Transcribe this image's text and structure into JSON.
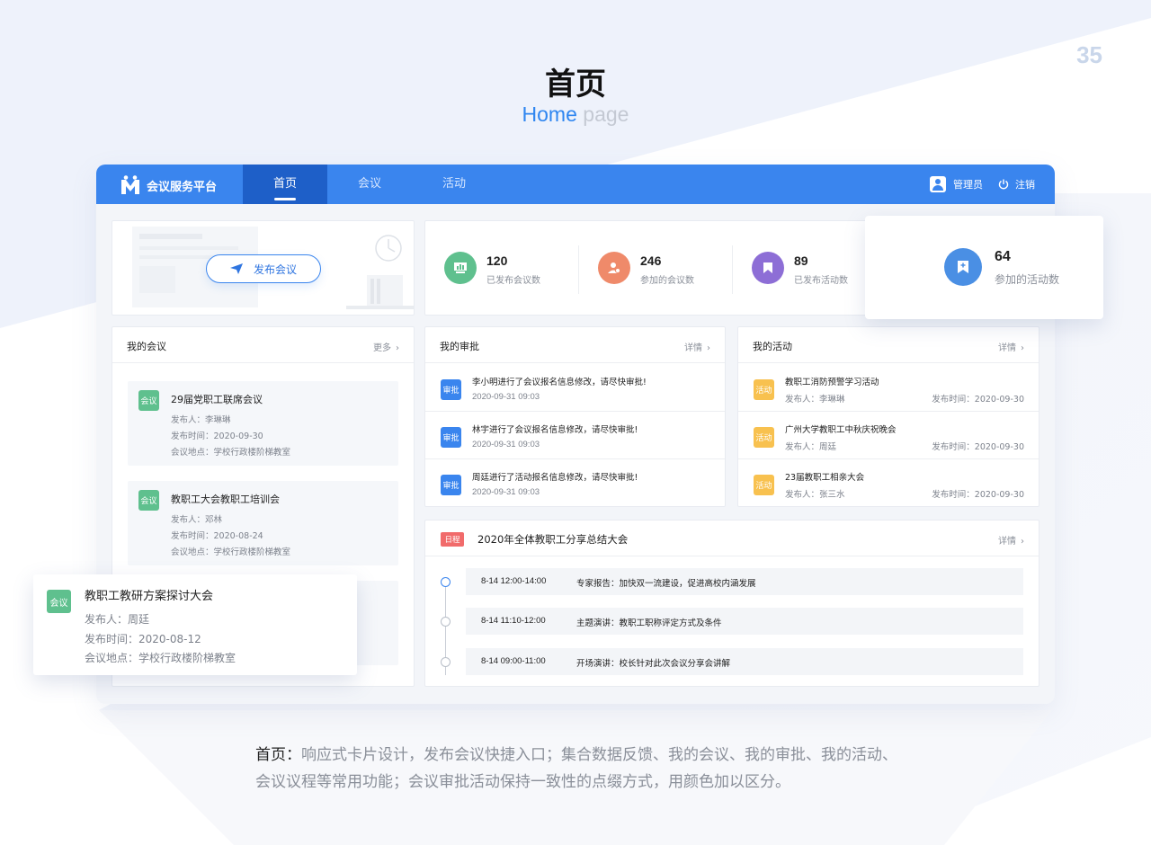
{
  "page_number": "35",
  "title": {
    "zh": "首页",
    "en_highlight": "Home",
    "en_muted": "page"
  },
  "topbar": {
    "brand": "会议服务平台",
    "nav": [
      {
        "label": "首页"
      },
      {
        "label": "会议"
      },
      {
        "label": "活动"
      }
    ],
    "user": "管理员",
    "logout": "注销"
  },
  "publish": {
    "button": "发布会议"
  },
  "stats": [
    {
      "value": "120",
      "label": "已发布会议数",
      "color": "#5fc08e"
    },
    {
      "value": "246",
      "label": "参加的会议数",
      "color": "#ef8a6a"
    },
    {
      "value": "89",
      "label": "已发布活动数",
      "color": "#8d6ed6"
    },
    {
      "value": "64",
      "label": "参加的活动数",
      "color": "#4a8fe4"
    }
  ],
  "meetings": {
    "title": "我的会议",
    "more": "更多",
    "tag": "会议",
    "items": [
      {
        "title": "29届党职工联席会议",
        "publisher": "发布人：李琳琳",
        "time": "发布时间：2020-09-30",
        "place": "会议地点：学校行政楼阶梯教室"
      },
      {
        "title": "教职工大会教职工培训会",
        "publisher": "发布人：邓林",
        "time": "发布时间：2020-08-24",
        "place": "会议地点：学校行政楼阶梯教室"
      }
    ],
    "floating": {
      "title": "教职工教研方案探讨大会",
      "publisher": "发布人：周廷",
      "time": "发布时间：2020-08-12",
      "place": "会议地点：学校行政楼阶梯教室"
    }
  },
  "approvals": {
    "title": "我的审批",
    "more": "详情",
    "tag": "审批",
    "items": [
      {
        "text": "李小明进行了会议报名信息修改，请尽快审批!",
        "time": "2020-09-31 09:03"
      },
      {
        "text": "林宇进行了会议报名信息修改，请尽快审批!",
        "time": "2020-09-31 09:03"
      },
      {
        "text": "周廷进行了活动报名信息修改，请尽快审批!",
        "time": "2020-09-31 09:03"
      }
    ]
  },
  "activities": {
    "title": "我的活动",
    "more": "详情",
    "tag": "活动",
    "items": [
      {
        "title": "教职工消防预警学习活动",
        "publisher": "发布人：李琳琳",
        "date": "发布时间：2020-09-30"
      },
      {
        "title": "广州大学教职工中秋庆祝晚会",
        "publisher": "发布人：周廷",
        "date": "发布时间：2020-09-30"
      },
      {
        "title": "23届教职工相亲大会",
        "publisher": "发布人：张三水",
        "date": "发布时间：2020-09-30"
      }
    ]
  },
  "schedule": {
    "tag": "日程",
    "title": "2020年全体教职工分享总结大会",
    "more": "详情",
    "items": [
      {
        "time": "8-14 12:00-14:00",
        "desc": "专家报告：加快双一流建设，促进高校内涵发展"
      },
      {
        "time": "8-14 11:10-12:00",
        "desc": "主题演讲：教职工职称评定方式及条件"
      },
      {
        "time": "8-14 09:00-11:00",
        "desc": "开场演讲：校长针对此次会议分享会讲解"
      }
    ]
  },
  "caption": {
    "lead": "首页：",
    "body": "响应式卡片设计，发布会议快捷入口；集合数据反馈、我的会议、我的审批、我的活动、会议议程等常用功能；会议审批活动保持一致性的点缀方式，用颜色加以区分。"
  },
  "colors": {
    "primary": "#3a85ee",
    "nav_active": "#1e5fc8",
    "green": "#5fc08e",
    "orange": "#f8c14f",
    "red": "#f16b6b"
  }
}
